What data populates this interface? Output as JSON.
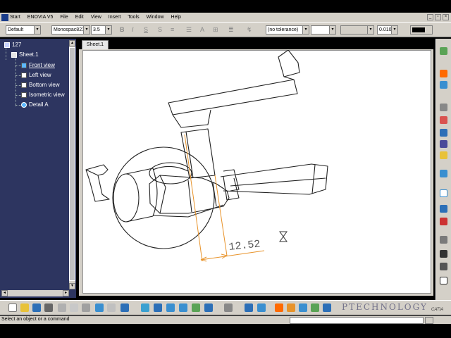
{
  "menu": {
    "start": "Start",
    "items": [
      "ENOVIA V5",
      "File",
      "Edit",
      "View",
      "Insert",
      "Tools",
      "Window",
      "Help"
    ]
  },
  "text_toolbar": {
    "style": "Default",
    "font": "Monospac821",
    "font_size": "3.5",
    "tolerance": "(no tolerance)",
    "precision": "0.010"
  },
  "tree": {
    "root": "127",
    "sheet": "Sheet.1",
    "views": [
      "Front view",
      "Left view",
      "Bottom view",
      "Isometric view",
      "Detail A"
    ]
  },
  "sheet_tab": "Sheet.1",
  "dimension": {
    "value": "12.52"
  },
  "logo_text": "PTECHNOLOGY",
  "brand": "CATIA",
  "status": {
    "message": "Select an object or a command"
  },
  "colors": {
    "tree_bg": "#2d3560",
    "dimension": "#e8932a",
    "ui_gray": "#d4d0c8"
  }
}
